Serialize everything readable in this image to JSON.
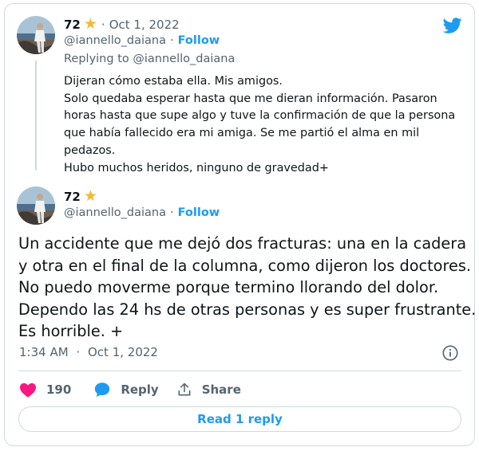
{
  "reply_tweet": {
    "display_name": "72",
    "date": "Oct 1, 2022",
    "handle": "@iannello_daiana",
    "follow_label": "Follow",
    "replying_to_prefix": "Replying to",
    "replying_to_handle": "@iannello_daiana",
    "lines": [
      "Dijeran cómo estaba ella. Mis amigos.",
      "Solo quedaba esperar hasta que me dieran información. Pasaron",
      "horas hasta que supe algo y tuve la confirmación de que la persona",
      "que había fallecido era mi amiga. Se me partió el alma en mil",
      "pedazos.",
      "Hubo muchos heridos, ninguno de gravedad+"
    ]
  },
  "main_tweet": {
    "display_name": "72",
    "handle": "@iannello_daiana",
    "follow_label": "Follow",
    "lines": [
      "Un accidente que me dejó dos fracturas: una en la cadera",
      "y otra en el final de la columna, como dijeron los doctores.",
      "No puedo moverme porque termino llorando del dolor.",
      "Dependo las 24 hs de otras personas y es super frustrante.",
      "Es horrible. +"
    ],
    "time": "1:34 AM",
    "date": "Oct 1, 2022",
    "like_count": "190",
    "reply_label": "Reply",
    "share_label": "Share",
    "read_replies_label": "Read 1 reply"
  },
  "separator": "·",
  "icons": {
    "star": "star-icon",
    "brand": "twitter-bird-icon",
    "like": "heart-icon",
    "reply": "speech-bubble-icon",
    "share": "share-upload-icon",
    "info": "info-icon"
  },
  "colors": {
    "accent": "#1d9bf0",
    "like": "#f91880",
    "star": "#f4ba2f",
    "muted": "#536471",
    "border": "#cfd9de"
  }
}
